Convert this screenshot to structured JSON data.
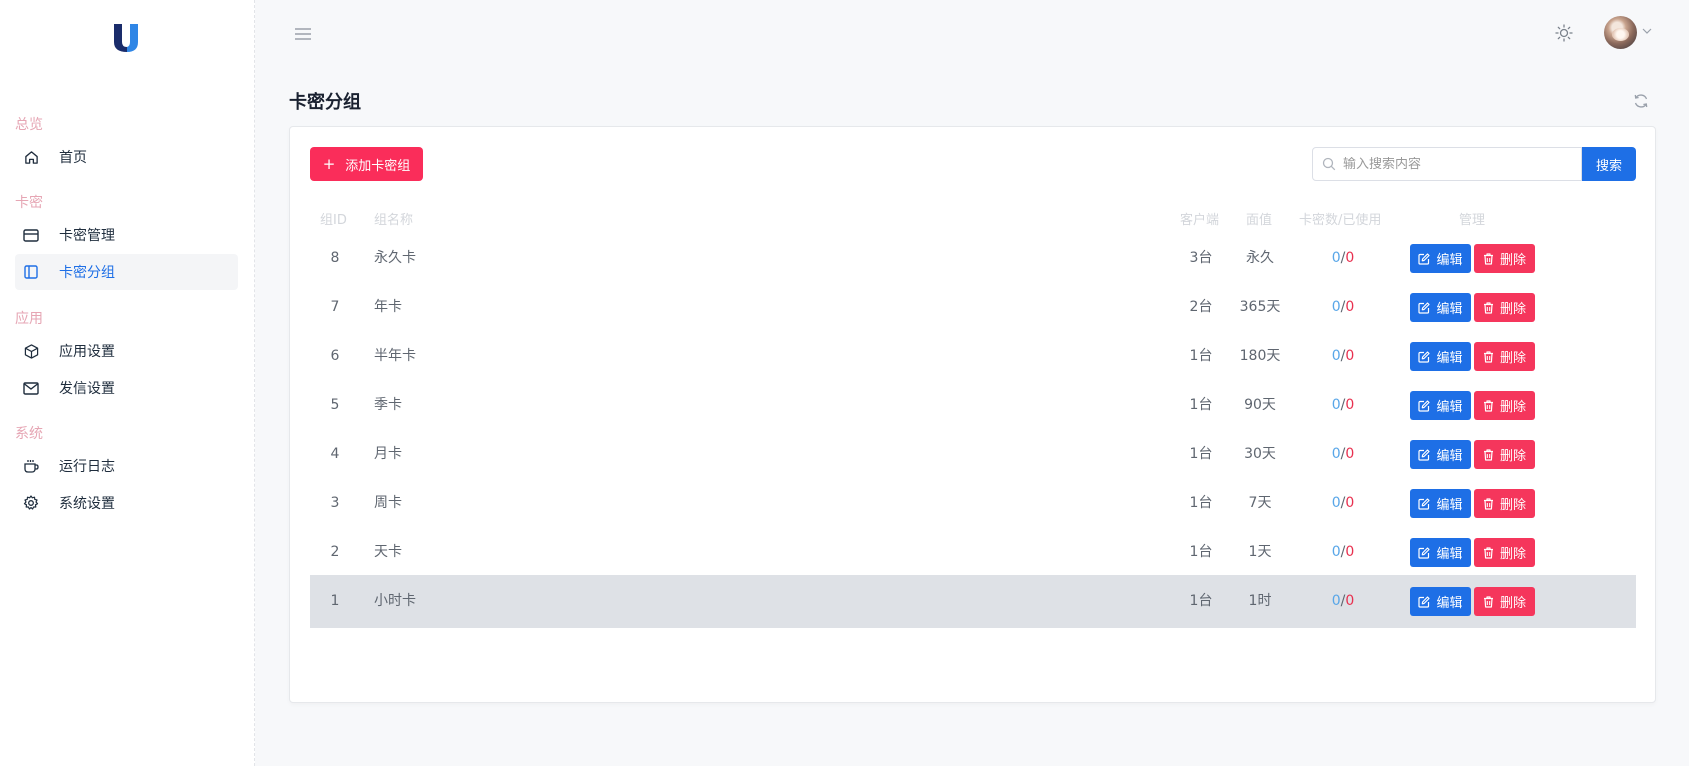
{
  "sidebar": {
    "sections": [
      {
        "title": "总览",
        "items": [
          {
            "label": "首页",
            "icon": "home-icon"
          }
        ]
      },
      {
        "title": "卡密",
        "items": [
          {
            "label": "卡密管理",
            "icon": "card-icon"
          },
          {
            "label": "卡密分组",
            "icon": "layout-icon",
            "active": true
          }
        ]
      },
      {
        "title": "应用",
        "items": [
          {
            "label": "应用设置",
            "icon": "box-icon"
          },
          {
            "label": "发信设置",
            "icon": "mail-icon"
          }
        ]
      },
      {
        "title": "系统",
        "items": [
          {
            "label": "运行日志",
            "icon": "cup-icon"
          },
          {
            "label": "系统设置",
            "icon": "gear-icon"
          }
        ]
      }
    ]
  },
  "page": {
    "title": "卡密分组"
  },
  "toolbar": {
    "add_label": "添加卡密组",
    "search_placeholder": "输入搜索内容",
    "search_label": "搜索"
  },
  "table": {
    "headers": {
      "id": "组ID",
      "name": "组名称",
      "client": "客户端",
      "face": "面值",
      "count": "卡密数/已使用",
      "manage": "管理"
    },
    "edit_label": "编辑",
    "delete_label": "删除",
    "rows": [
      {
        "id": "8",
        "name": "永久卡",
        "client": "3台",
        "face": "永久",
        "used": "0",
        "total": "0"
      },
      {
        "id": "7",
        "name": "年卡",
        "client": "2台",
        "face": "365天",
        "used": "0",
        "total": "0"
      },
      {
        "id": "6",
        "name": "半年卡",
        "client": "1台",
        "face": "180天",
        "used": "0",
        "total": "0"
      },
      {
        "id": "5",
        "name": "季卡",
        "client": "1台",
        "face": "90天",
        "used": "0",
        "total": "0"
      },
      {
        "id": "4",
        "name": "月卡",
        "client": "1台",
        "face": "30天",
        "used": "0",
        "total": "0"
      },
      {
        "id": "3",
        "name": "周卡",
        "client": "1台",
        "face": "7天",
        "used": "0",
        "total": "0"
      },
      {
        "id": "2",
        "name": "天卡",
        "client": "1台",
        "face": "1天",
        "used": "0",
        "total": "0"
      },
      {
        "id": "1",
        "name": "小时卡",
        "client": "1台",
        "face": "1时",
        "used": "0",
        "total": "0",
        "highlighted": true
      }
    ]
  },
  "colors": {
    "primary": "#1e6fe6",
    "danger": "#fa2d5a",
    "section": "#e6a6b4"
  }
}
